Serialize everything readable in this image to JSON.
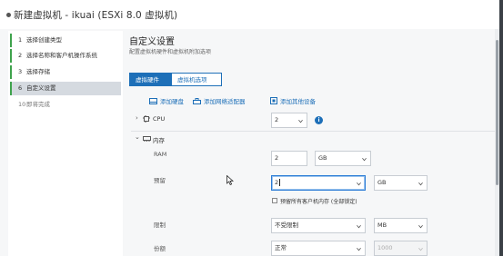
{
  "window": {
    "title": "新建虚拟机 - ikuai (ESXi 8.0 虚拟机)"
  },
  "steps": [
    {
      "num": "1",
      "label": "选择创建类型",
      "state": "done"
    },
    {
      "num": "2",
      "label": "选择名称和客户机操作系统",
      "state": "done"
    },
    {
      "num": "3",
      "label": "选择存储",
      "state": "done"
    },
    {
      "num": "6",
      "label": "自定义设置",
      "state": "active"
    },
    {
      "num": "10",
      "label": "即将完成",
      "state": "todo"
    }
  ],
  "section": {
    "title": "自定义设置",
    "subtitle": "配置虚拟机硬件和虚拟机附加选项"
  },
  "tabs": [
    {
      "label": "虚拟硬件",
      "active": true
    },
    {
      "label": "虚拟机选项",
      "active": false
    }
  ],
  "toolbar": {
    "add_disk": "添加硬盘",
    "add_nic": "添加网络适配器",
    "add_other": "添加其他设备"
  },
  "hardware": {
    "cpu": {
      "label": "CPU",
      "value": "2"
    },
    "memory": {
      "label": "内存",
      "ram_label": "RAM",
      "ram_value": "2",
      "ram_unit": "GB",
      "reservation_label": "预留",
      "reservation_value": "2",
      "reservation_unit": "GB",
      "reserve_all_label": "预留所有客户机内存 (全部锁定)",
      "limit_label": "限制",
      "limit_value": "不受限制",
      "limit_unit": "MB",
      "shares_label": "份额",
      "shares_value": "正常",
      "shares_number": "1000"
    }
  },
  "colors": {
    "accent": "#1d6fb8",
    "step_done": "#3fa34d",
    "focus": "#2a7bd6"
  }
}
